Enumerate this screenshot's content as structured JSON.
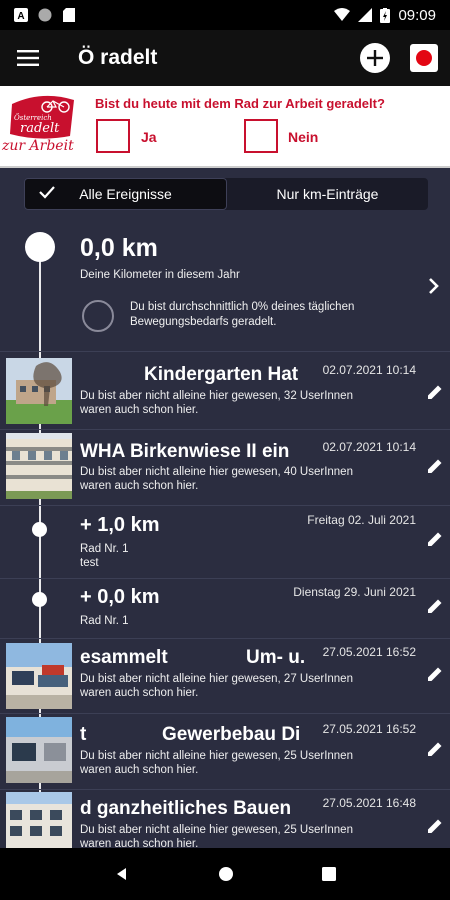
{
  "status": {
    "time": "09:09"
  },
  "app": {
    "title": "Ö radelt"
  },
  "banner": {
    "logo_top": "Österreich",
    "logo_mid": "radelt",
    "logo_script": "zur Arbeit",
    "question": "Bist du heute mit dem Rad zur Arbeit geradelt?",
    "yes": "Ja",
    "no": "Nein"
  },
  "segments": {
    "all": "Alle Ereignisse",
    "km_only": "Nur km-Einträge"
  },
  "summary": {
    "km": "0,0 km",
    "subtitle": "Deine Kilometer in diesem Jahr",
    "motion_line1": "Du bist durchschnittlich 0% deines täglichen",
    "motion_line2": "Bewegungsbedarfs geradelt."
  },
  "entries": [
    {
      "title": "Kindergarten Hat",
      "date": "02.07.2021 10:14",
      "line1": "Du bist aber nicht alleine hier gewesen, 32 UserInnen",
      "line2": "waren auch schon hier."
    },
    {
      "title": "WHA Birkenwiese II ein",
      "date": "02.07.2021 10:14",
      "line1": "Du bist aber nicht alleine hier gewesen, 40 UserInnen",
      "line2": "waren auch schon hier."
    },
    {
      "km": "+ 1,0 km",
      "date": "Freitag 02. Juli 2021",
      "line1": "Rad Nr. 1",
      "line2": "test"
    },
    {
      "km": "+ 0,0 km",
      "date": "Dienstag 29. Juni 2021",
      "line1": "Rad Nr. 1"
    },
    {
      "title_left": "esammelt",
      "title_right": "Um- u.",
      "date": "27.05.2021 16:52",
      "line1": "Du bist aber nicht alleine hier gewesen, 27 UserInnen",
      "line2": "waren auch schon hier."
    },
    {
      "title_left": "t",
      "title_right": "Gewerbebau Di",
      "date": "27.05.2021 16:52",
      "line1": "Du bist aber nicht alleine hier gewesen, 25 UserInnen",
      "line2": "waren auch schon hier."
    },
    {
      "title": "d ganzheitliches Bauen",
      "date": "27.05.2021 16:48",
      "line1": "Du bist aber nicht alleine hier gewesen, 25 UserInnen",
      "line2": "waren auch schon hier."
    }
  ]
}
